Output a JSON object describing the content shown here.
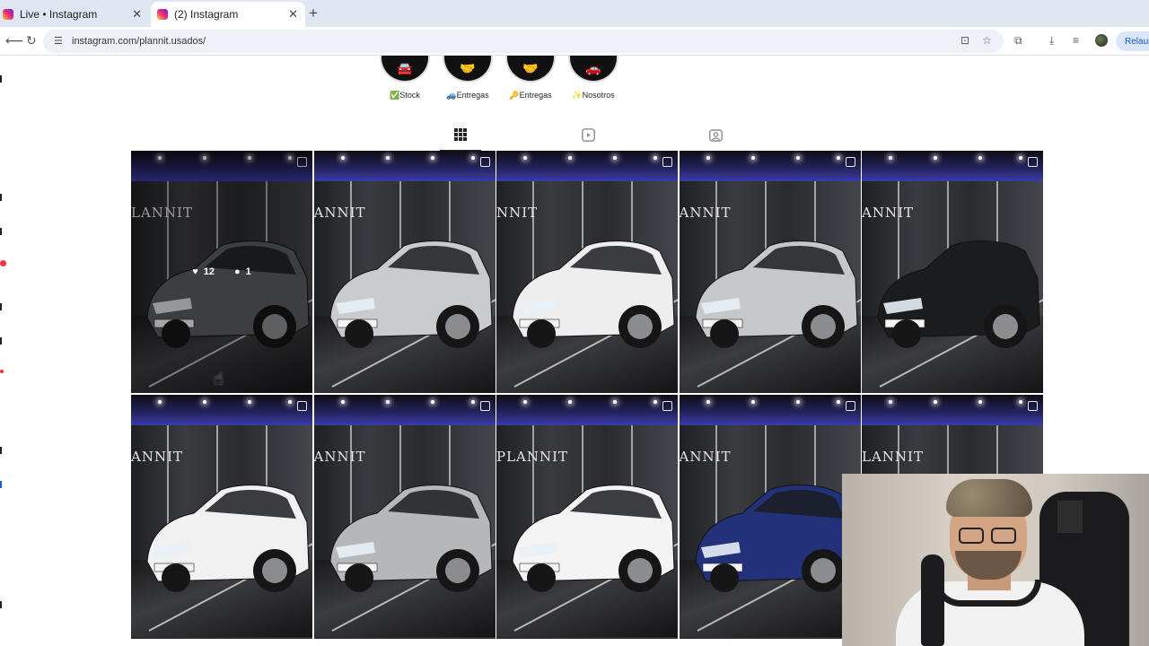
{
  "browser": {
    "tabs": [
      {
        "title": "Live • Instagram",
        "active": false
      },
      {
        "title": "(2) Instagram",
        "active": true
      }
    ],
    "url": "instagram.com/plannit.usados/",
    "relaunch_label": "Relaun",
    "colors": {
      "accent": "#1a56c4",
      "tabbar": "#dfe7f3",
      "notification": "#ff3040"
    }
  },
  "highlights": [
    {
      "emoji": "✅",
      "label": "Stock"
    },
    {
      "emoji": "🚙",
      "label": "Entregas"
    },
    {
      "emoji": "🔑",
      "label": "Entregas"
    },
    {
      "emoji": "✨",
      "label": "Nosotros"
    }
  ],
  "profile_tabs": [
    {
      "icon": "grid-icon",
      "active": true
    },
    {
      "icon": "reels-icon",
      "active": false
    },
    {
      "icon": "tagged-icon",
      "active": false
    }
  ],
  "posts": [
    {
      "brand": "LANNIT",
      "car_color": "#5a5c60",
      "hover": true,
      "likes": "12",
      "comments": "1"
    },
    {
      "brand": "ANNIT",
      "car_color": "#c9cbce"
    },
    {
      "brand": "NNIT",
      "car_color": "#eeeeee"
    },
    {
      "brand": "ANNIT",
      "car_color": "#c5c7ca"
    },
    {
      "brand": "ANNIT",
      "car_color": "#1b1c1e"
    },
    {
      "brand": "ANNIT",
      "car_color": "#f1f1f1"
    },
    {
      "brand": "ANNIT",
      "car_color": "#b5b7ba"
    },
    {
      "brand": "PLANNIT",
      "car_color": "#f4f4f4"
    },
    {
      "brand": "ANNIT",
      "car_color": "#23307a"
    },
    {
      "brand": "LANNIT",
      "car_color": "#cfd1d4"
    }
  ]
}
